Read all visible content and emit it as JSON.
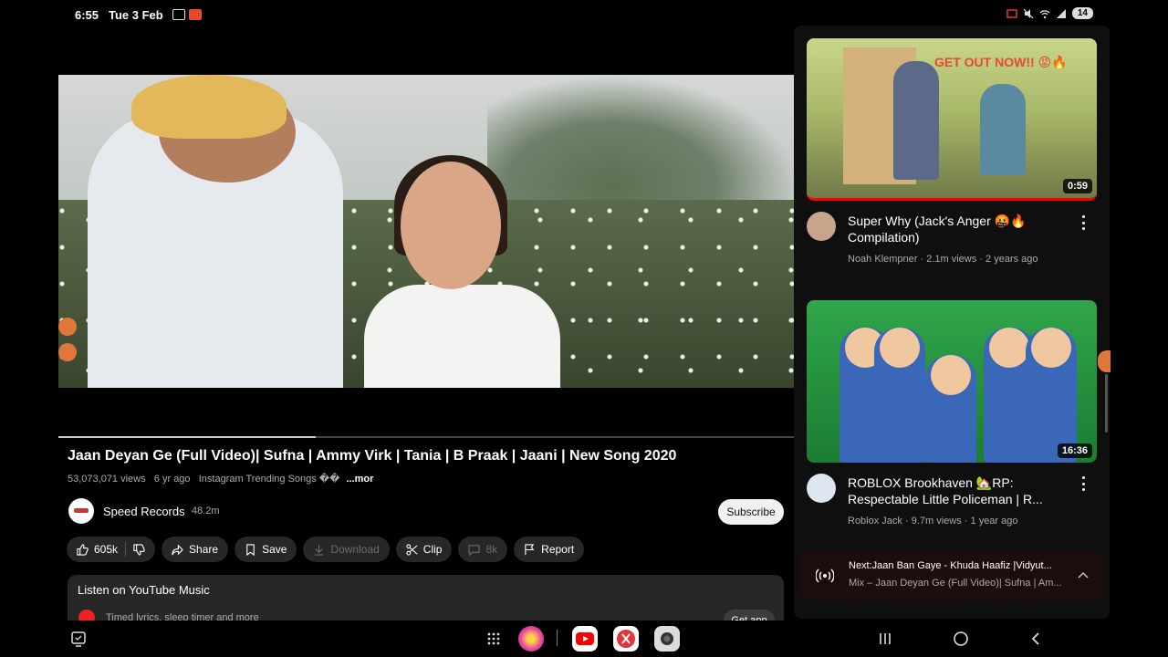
{
  "status_bar": {
    "time": "6:55",
    "date": "Tue 3 Feb",
    "battery": "14",
    "icons": [
      "screen-record-icon",
      "cast-icon",
      "mute-icon",
      "wifi-icon",
      "signal-icon"
    ]
  },
  "player": {
    "progress_fraction": 0.35
  },
  "video": {
    "title": "Jaan Deyan Ge (Full Video)| Sufna | Ammy Virk | Tania | B Praak | Jaani | New Song 2020",
    "views": "53,073,071 views",
    "age": "6 yr ago",
    "tags": "Instagram Trending Songs ��",
    "more": "...mor"
  },
  "channel": {
    "name": "Speed Records",
    "subscribers": "48.2m",
    "subscribe_label": "Subscribe"
  },
  "actions": {
    "likes": "605k",
    "share": "Share",
    "save": "Save",
    "download": "Download",
    "clip": "Clip",
    "comments": "8k",
    "report": "Report"
  },
  "youtube_music": {
    "title": "Listen on YouTube Music",
    "subtitle": "Timed lyrics, sleep timer and more",
    "button": "Get app"
  },
  "recommendations": [
    {
      "thumb_text": "GET OUT NOW!! 😡🔥",
      "duration": "0:59",
      "title": "Super Why (Jack's Anger 🤬🔥 Compilation)",
      "channel": "Noah Klempner",
      "views": "2.1m views",
      "age": "2 years ago"
    },
    {
      "duration": "16:36",
      "title": "ROBLOX Brookhaven 🏡RP: Respectable Little Policeman | R...",
      "channel": "Roblox Jack",
      "views": "9.7m views",
      "age": "1 year ago"
    }
  ],
  "next_up": {
    "line1": "Next:Jaan Ban Gaye - Khuda Haafiz |Vidyut...",
    "line2": "Mix – Jaan Deyan Ge (Full Video)| Sufna | Am..."
  },
  "nav": {
    "apps": [
      "app-drawer-icon",
      "blossom-app-icon",
      "youtube-app-icon",
      "kinemaster-app-icon",
      "camera-app-icon"
    ]
  },
  "colors": {
    "background": "#000000",
    "panel": "#0f0f0f",
    "pill": "#272727",
    "accent_red": "#ff0000",
    "subscribe_bg": "#f1f1f1"
  }
}
